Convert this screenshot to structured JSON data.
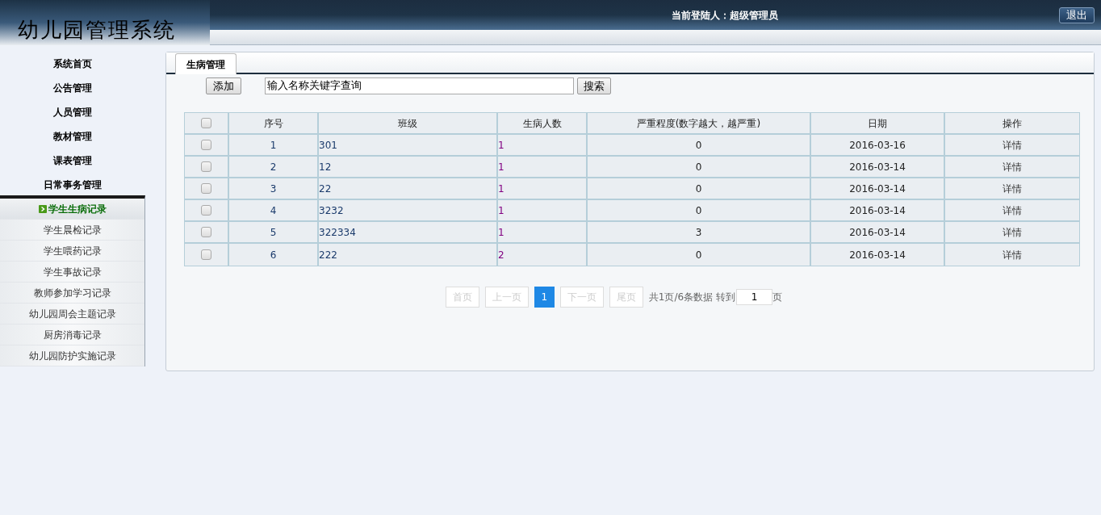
{
  "header": {
    "logo": "幼儿园管理系统",
    "user_label": "当前登陆人：",
    "user_name": "超级管理员",
    "logout": "退出"
  },
  "sidebar": {
    "menu": [
      {
        "label": "系统首页"
      },
      {
        "label": "公告管理"
      },
      {
        "label": "人员管理"
      },
      {
        "label": "教材管理"
      },
      {
        "label": "课表管理"
      },
      {
        "label": "日常事务管理",
        "expanded": true,
        "children": [
          {
            "label": "学生生病记录",
            "selected": true
          },
          {
            "label": "学生晨检记录",
            "selected": false
          },
          {
            "label": "学生喂药记录",
            "selected": false
          },
          {
            "label": "学生事故记录",
            "selected": false
          },
          {
            "label": "教师参加学习记录",
            "selected": false
          },
          {
            "label": "幼儿园周会主题记录",
            "selected": false
          },
          {
            "label": "厨房消毒记录",
            "selected": false
          },
          {
            "label": "幼儿园防护实施记录",
            "selected": false
          }
        ]
      }
    ]
  },
  "panel": {
    "tab": "生病管理",
    "add_button": "添加",
    "search": {
      "value": "输入名称关键字查询"
    },
    "search_button": "搜索"
  },
  "table": {
    "columns": [
      "序号",
      "班级",
      "生病人数",
      "严重程度(数字越大，越严重)",
      "日期",
      "操作"
    ],
    "header_checked": false,
    "rows": [
      {
        "checked": false,
        "cells": [
          "1",
          "301",
          "1",
          "0",
          "2016-03-16",
          "详情"
        ]
      },
      {
        "checked": false,
        "cells": [
          "2",
          "12",
          "1",
          "0",
          "2016-03-14",
          "详情"
        ]
      },
      {
        "checked": false,
        "cells": [
          "3",
          "22",
          "1",
          "0",
          "2016-03-14",
          "详情"
        ]
      },
      {
        "checked": false,
        "cells": [
          "4",
          "3232",
          "1",
          "0",
          "2016-03-14",
          "详情"
        ]
      },
      {
        "checked": false,
        "cells": [
          "5",
          "322334",
          "1",
          "3",
          "2016-03-14",
          "详情"
        ]
      },
      {
        "checked": false,
        "cells": [
          "6",
          "222",
          "2",
          "0",
          "2016-03-14",
          "详情"
        ]
      }
    ]
  },
  "pagination": {
    "buttons": [
      {
        "label": "首页",
        "kind": "nav",
        "disabled": true
      },
      {
        "label": "上一页",
        "kind": "nav",
        "disabled": true
      },
      {
        "label": "1",
        "kind": "page",
        "selected": true
      },
      {
        "label": "下一页",
        "kind": "nav",
        "disabled": true
      },
      {
        "label": "尾页",
        "kind": "nav",
        "disabled": true
      }
    ],
    "summary": "共1页/6条数据",
    "goto_label": "转到",
    "goto_value": "1",
    "page_unit": "页"
  }
}
